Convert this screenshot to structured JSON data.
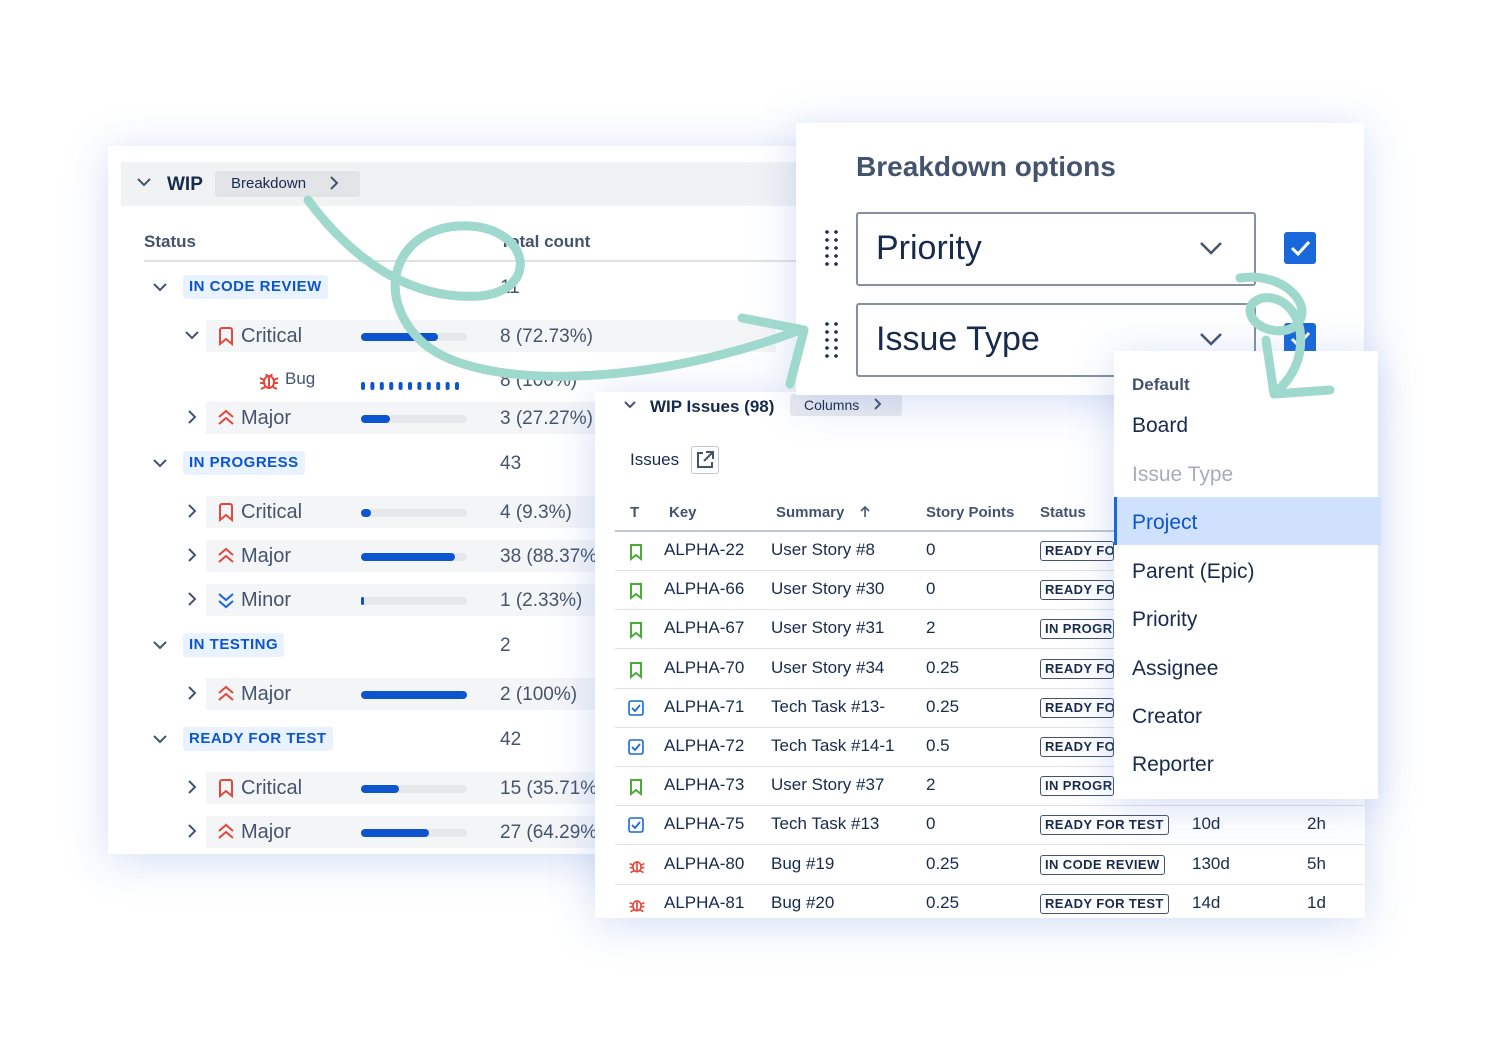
{
  "wip": {
    "title": "WIP",
    "breakdown_label": "Breakdown",
    "col_status": "Status",
    "col_total": "Total count",
    "groups": [
      {
        "status": "IN CODE REVIEW",
        "count": "11",
        "rows": [
          {
            "label": "Critical",
            "value": "8 (72.73%)",
            "fraction": 0.7273,
            "icon": "critical-priority-icon"
          },
          {
            "label": "Bug",
            "value": "8 (100%)",
            "fraction": 1.0,
            "icon": "bug-icon",
            "dotted": true
          },
          {
            "label": "Major",
            "value": "3 (27.27%)",
            "fraction": 0.2727,
            "icon": "major-priority-icon"
          }
        ]
      },
      {
        "status": "IN PROGRESS",
        "count": "43",
        "rows": [
          {
            "label": "Critical",
            "value": "4 (9.3%)",
            "fraction": 0.093,
            "icon": "critical-priority-icon"
          },
          {
            "label": "Major",
            "value": "38 (88.37%)",
            "fraction": 0.8837,
            "icon": "major-priority-icon"
          },
          {
            "label": "Minor",
            "value": "1 (2.33%)",
            "fraction": 0.0233,
            "icon": "minor-priority-icon"
          }
        ]
      },
      {
        "status": "IN TESTING",
        "count": "2",
        "rows": [
          {
            "label": "Major",
            "value": "2 (100%)",
            "fraction": 1.0,
            "icon": "major-priority-icon"
          }
        ]
      },
      {
        "status": "READY FOR TEST",
        "count": "42",
        "rows": [
          {
            "label": "Critical",
            "value": "15 (35.71%)",
            "fraction": 0.3571,
            "icon": "critical-priority-icon"
          },
          {
            "label": "Major",
            "value": "27 (64.29%)",
            "fraction": 0.6429,
            "icon": "major-priority-icon"
          }
        ]
      }
    ]
  },
  "breakdown_options": {
    "title": "Breakdown options",
    "selects": [
      {
        "value": "Priority",
        "checked": true
      },
      {
        "value": "Issue Type",
        "checked": true
      }
    ]
  },
  "issues": {
    "title": "WIP Issues (98)",
    "columns_label": "Columns",
    "issues_label": "Issues",
    "headers": {
      "t": "T",
      "key": "Key",
      "summary": "Summary",
      "points": "Story Points",
      "status": "Status"
    },
    "rows": [
      {
        "type": "story",
        "key": "ALPHA-22",
        "summary": "User Story #8",
        "points": "0",
        "status": "READY FOR TEST",
        "c1": "",
        "c2": ""
      },
      {
        "type": "story",
        "key": "ALPHA-66",
        "summary": "User Story #30",
        "points": "0",
        "status": "READY FOR TEST",
        "c1": "",
        "c2": ""
      },
      {
        "type": "story",
        "key": "ALPHA-67",
        "summary": "User Story #31",
        "points": "2",
        "status": "IN PROGRESS",
        "c1": "",
        "c2": ""
      },
      {
        "type": "story",
        "key": "ALPHA-70",
        "summary": "User Story #34",
        "points": "0.25",
        "status": "READY FOR TEST",
        "c1": "",
        "c2": ""
      },
      {
        "type": "task",
        "key": "ALPHA-71",
        "summary": "Tech Task #13-",
        "points": "0.25",
        "status": "READY FOR TEST",
        "c1": "",
        "c2": ""
      },
      {
        "type": "task",
        "key": "ALPHA-72",
        "summary": "Tech Task #14-1",
        "points": "0.5",
        "status": "READY FOR TEST",
        "c1": "",
        "c2": ""
      },
      {
        "type": "story",
        "key": "ALPHA-73",
        "summary": "User Story #37",
        "points": "2",
        "status": "IN PROGRESS",
        "c1": "",
        "c2": ""
      },
      {
        "type": "task",
        "key": "ALPHA-75",
        "summary": "Tech Task #13",
        "points": "0",
        "status": "READY FOR TEST",
        "c1": "10d",
        "c2": "2h"
      },
      {
        "type": "bug",
        "key": "ALPHA-80",
        "summary": "Bug #19",
        "points": "0.25",
        "status": "IN CODE REVIEW",
        "c1": "130d",
        "c2": "5h"
      },
      {
        "type": "bug",
        "key": "ALPHA-81",
        "summary": "Bug #20",
        "points": "0.25",
        "status": "READY FOR TEST",
        "c1": "14d",
        "c2": "1d"
      }
    ]
  },
  "dropdown": {
    "section": "Default",
    "items": [
      "Board",
      "Issue Type",
      "Project",
      "Parent (Epic)",
      "Priority",
      "Assignee",
      "Creator",
      "Reporter"
    ],
    "disabled": "Issue Type",
    "selected": "Project"
  },
  "colors": {
    "accent": "#0c55cf",
    "critical": "#e2483d",
    "story": "#4bab38",
    "task": "#1868db",
    "annotation_arrow": "#9fd8cc"
  }
}
